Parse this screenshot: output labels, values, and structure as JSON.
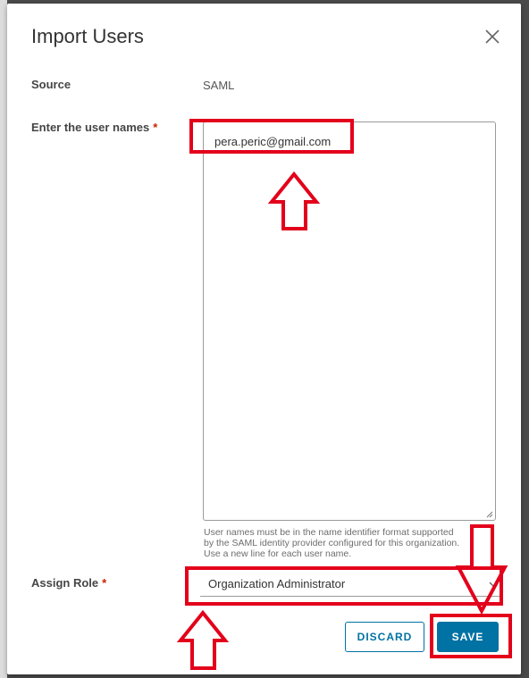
{
  "dialog": {
    "title": "Import Users",
    "close_icon": "close-icon"
  },
  "form": {
    "source_label": "Source",
    "source_value": "SAML",
    "usernames_label": "Enter the user names",
    "required_marker": "*",
    "usernames_value": "pera.peric@gmail.com",
    "helper_lines": [
      "User names must be in the name identifier format supported",
      "by the SAML identity provider configured for this organization.",
      "Use a new line for each user name."
    ],
    "role_label": "Assign Role",
    "role_selected": "Organization Administrator"
  },
  "buttons": {
    "discard": "DISCARD",
    "save": "SAVE"
  },
  "colors": {
    "primary": "#0072a3",
    "required": "#c92100",
    "annotation": "#e3001b"
  },
  "annotations": {
    "icons": [
      "highlight-box",
      "up-arrow-icon",
      "down-arrow-icon"
    ]
  }
}
